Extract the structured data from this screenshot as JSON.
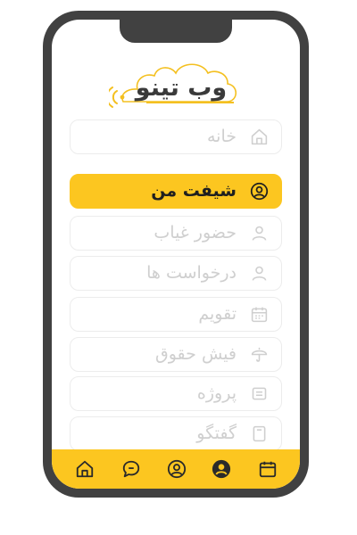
{
  "logo": {
    "text": "وب تینو"
  },
  "menu": {
    "items": [
      {
        "label": "خانه",
        "icon": "home-icon",
        "active": false
      },
      {
        "label": "شیفت من",
        "icon": "user-circle-icon",
        "active": true
      },
      {
        "label": "حضور غیاب",
        "icon": "user-icon",
        "active": false
      },
      {
        "label": "درخواست ها",
        "icon": "user-icon",
        "active": false
      },
      {
        "label": "تقویم",
        "icon": "calendar-icon",
        "active": false
      },
      {
        "label": "فیش حقوق",
        "icon": "umbrella-icon",
        "active": false
      },
      {
        "label": "پروژه",
        "icon": "card-icon",
        "active": false
      },
      {
        "label": "گفتگو",
        "icon": "document-icon",
        "active": false
      }
    ]
  },
  "bottom_nav": {
    "items": [
      "home-icon",
      "chat-icon",
      "user-circle-icon",
      "user-circle-filled-icon",
      "calendar-icon"
    ]
  },
  "colors": {
    "accent": "#fcc620",
    "phone_frame": "#414141",
    "inactive_text": "#cfcfcf",
    "active_text": "#1f1f1f"
  }
}
